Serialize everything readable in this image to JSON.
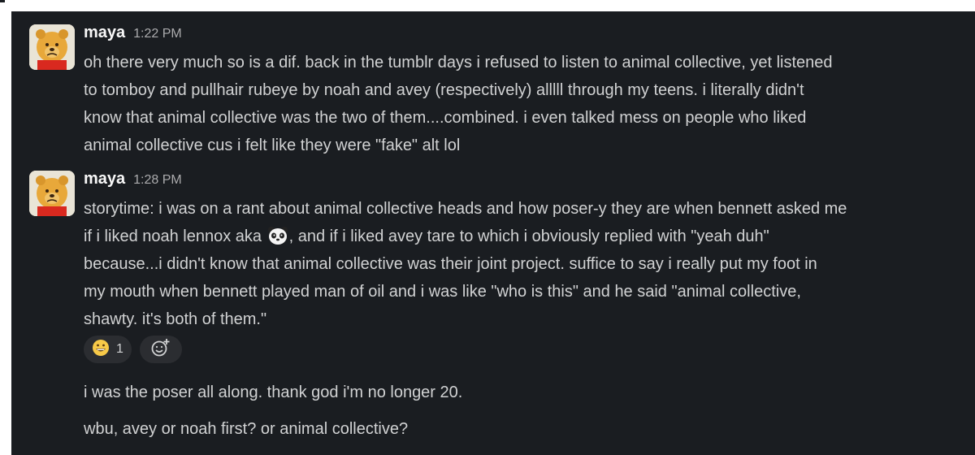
{
  "messages": [
    {
      "username": "maya",
      "timestamp": "1:22 PM",
      "lines": [
        "oh there very much so is a dif. back in the tumblr days i refused to listen to animal collective, yet listened",
        "to tomboy and pullhair rubeye by noah and avey (respectively) alllll through my teens. i literally didn't",
        "know that animal collective was the two of them....combined. i even talked mess on people who liked",
        "animal collective cus i felt like they were \"fake\" alt lol"
      ]
    },
    {
      "username": "maya",
      "timestamp": "1:28 PM",
      "line1": "storytime: i was on a rant about animal collective heads and how poser-y they are when bennett asked me",
      "line2_before": "if i liked noah lennox aka ",
      "line2_emoji": "panda-emoji",
      "line2_after": ", and if i liked avey tare to which i obviously replied with \"yeah duh\"",
      "lines_rest": [
        "because...i didn't know that animal collective was their joint project. suffice to say i really put my foot in",
        "my mouth when bennett played man of oil and i was like \"who is this\" and he said \"animal collective,",
        "shawty. it's both of them.\""
      ],
      "reaction": {
        "emoji": "grinning-face-emoji",
        "count": "1"
      },
      "add_reaction_icon": "add-reaction-icon"
    }
  ],
  "followups": [
    "i was the poser all along. thank god i'm no longer 20.",
    "wbu, avey or noah first? or animal collective?"
  ],
  "colors": {
    "background": "#1a1d21",
    "text": "#d1d2d3",
    "username": "#f8f8f8",
    "timestamp": "#ababad",
    "reaction_pill": "#2b2d31"
  }
}
